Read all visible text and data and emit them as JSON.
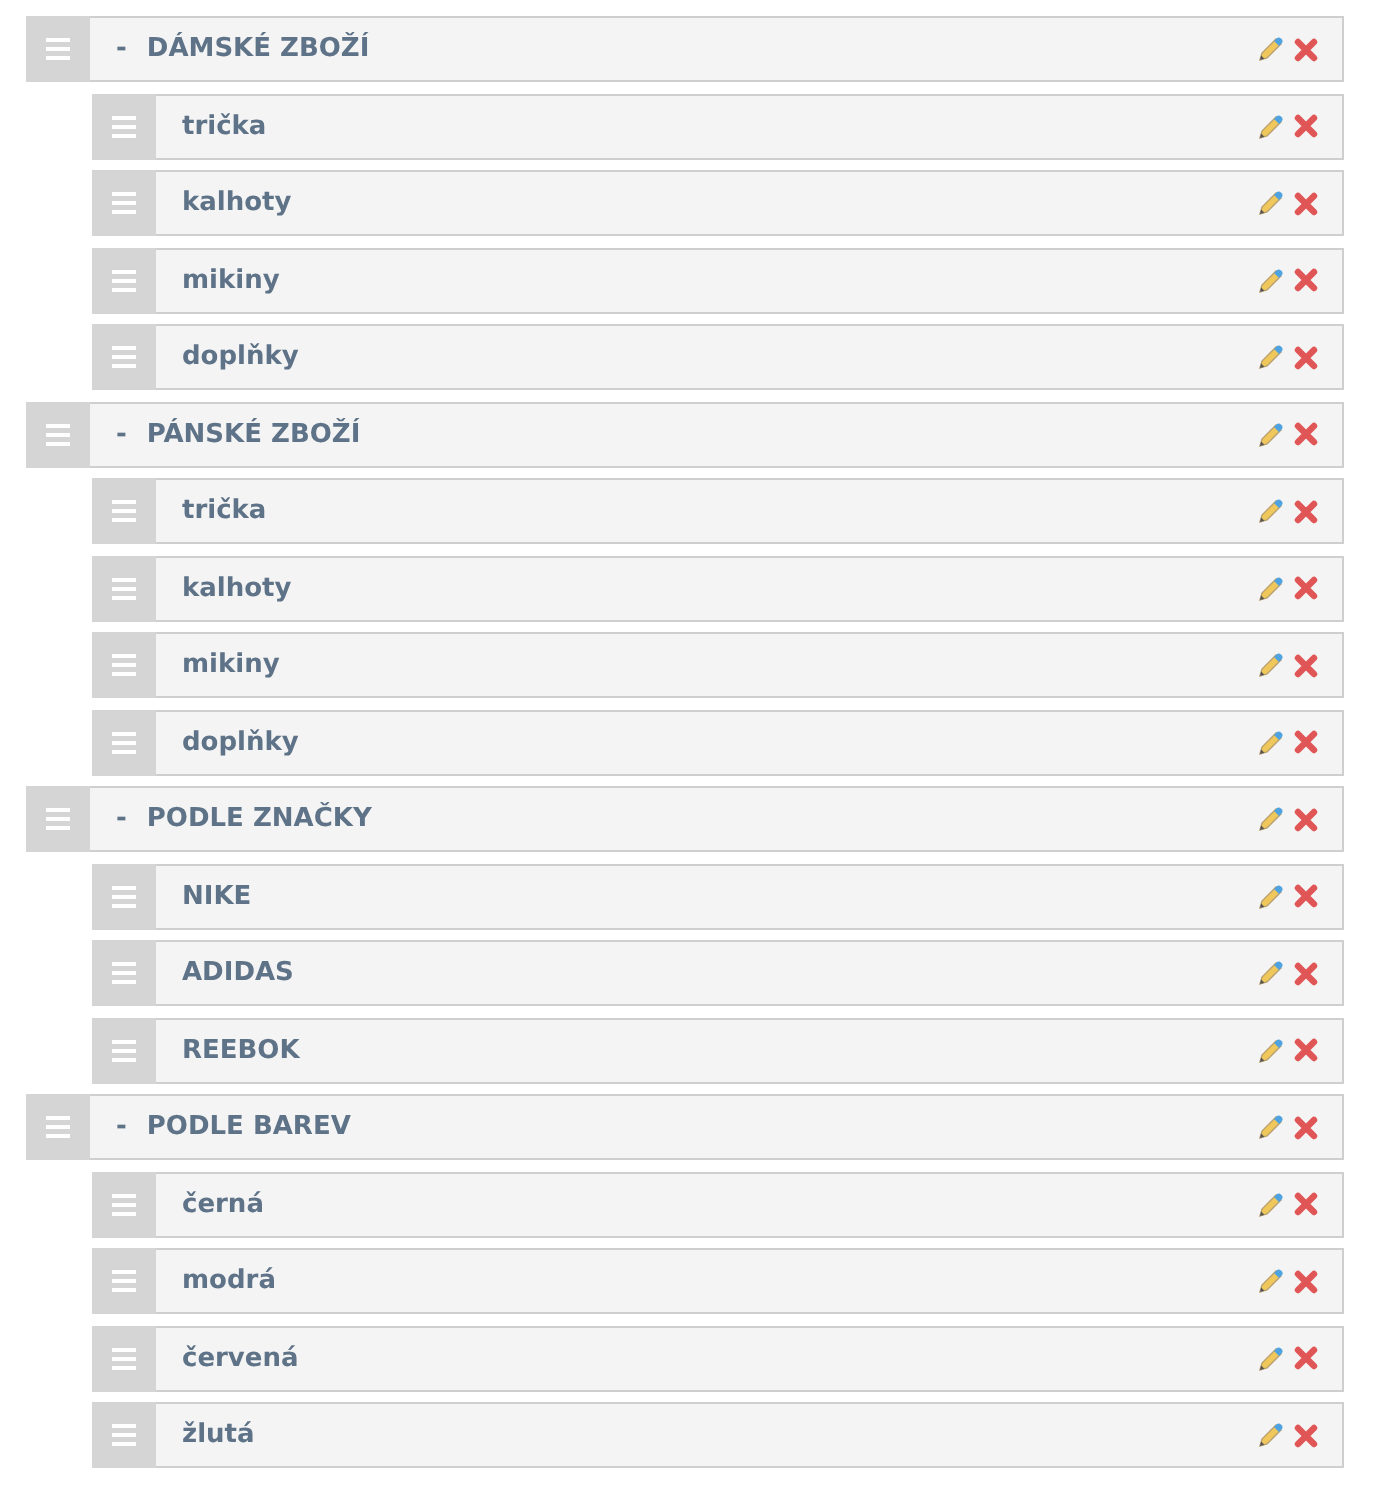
{
  "categories": [
    {
      "label": "DÁMSKÉ ZBOŽÍ",
      "toggle": "-",
      "children": [
        {
          "label": "trička"
        },
        {
          "label": "kalhoty"
        },
        {
          "label": "mikiny"
        },
        {
          "label": "doplňky"
        }
      ]
    },
    {
      "label": "PÁNSKÉ ZBOŽÍ",
      "toggle": "-",
      "children": [
        {
          "label": "trička"
        },
        {
          "label": "kalhoty"
        },
        {
          "label": "mikiny"
        },
        {
          "label": "doplňky"
        }
      ]
    },
    {
      "label": "PODLE ZNAČKY",
      "toggle": "-",
      "children": [
        {
          "label": "NIKE"
        },
        {
          "label": "ADIDAS"
        },
        {
          "label": "REEBOK"
        }
      ]
    },
    {
      "label": "PODLE BAREV",
      "toggle": "-",
      "children": [
        {
          "label": "černá"
        },
        {
          "label": "modrá"
        },
        {
          "label": "červená"
        },
        {
          "label": "žlutá"
        }
      ]
    }
  ]
}
